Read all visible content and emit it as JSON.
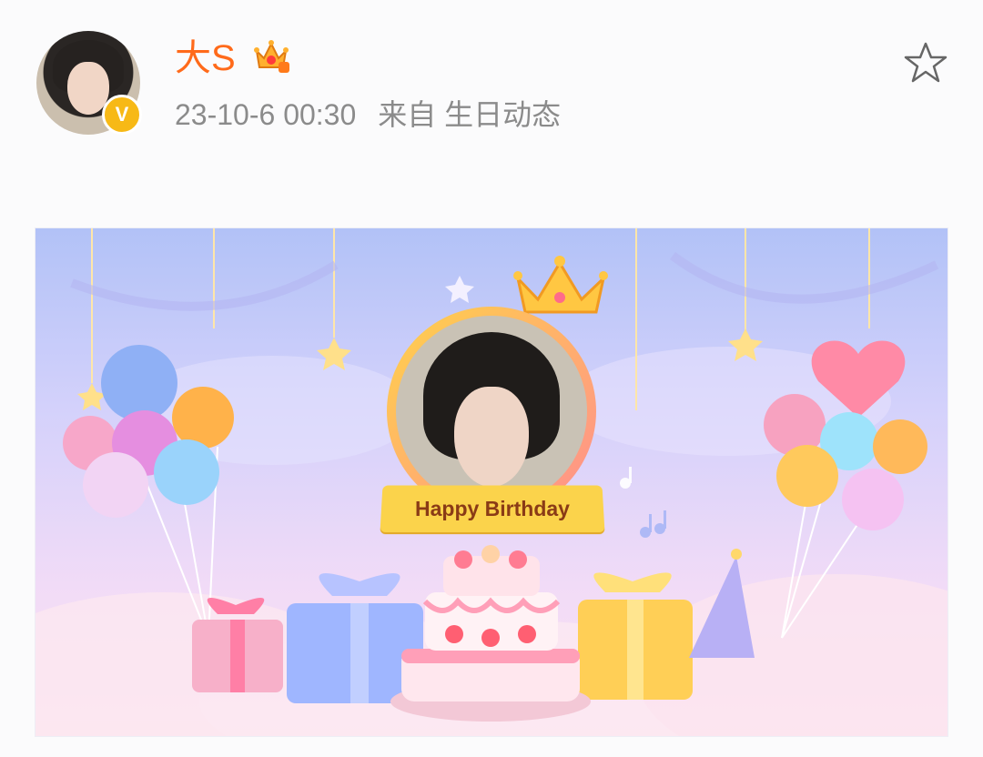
{
  "post": {
    "user_name": "大S",
    "timestamp": "23-10-6 00:30",
    "source": "来自 生日动态"
  },
  "card": {
    "banner_text": "Happy Birthday"
  },
  "icons": {
    "avatar_badge": "verified-v-icon",
    "name_badge": "crown-member-badge-icon",
    "favorite": "star-outline-icon"
  },
  "colors": {
    "name": "#ff6a1a",
    "meta": "#8b8b8b",
    "verified_badge": "#f7b916",
    "banner": "#fbd34b",
    "banner_text": "#8a3b16"
  }
}
